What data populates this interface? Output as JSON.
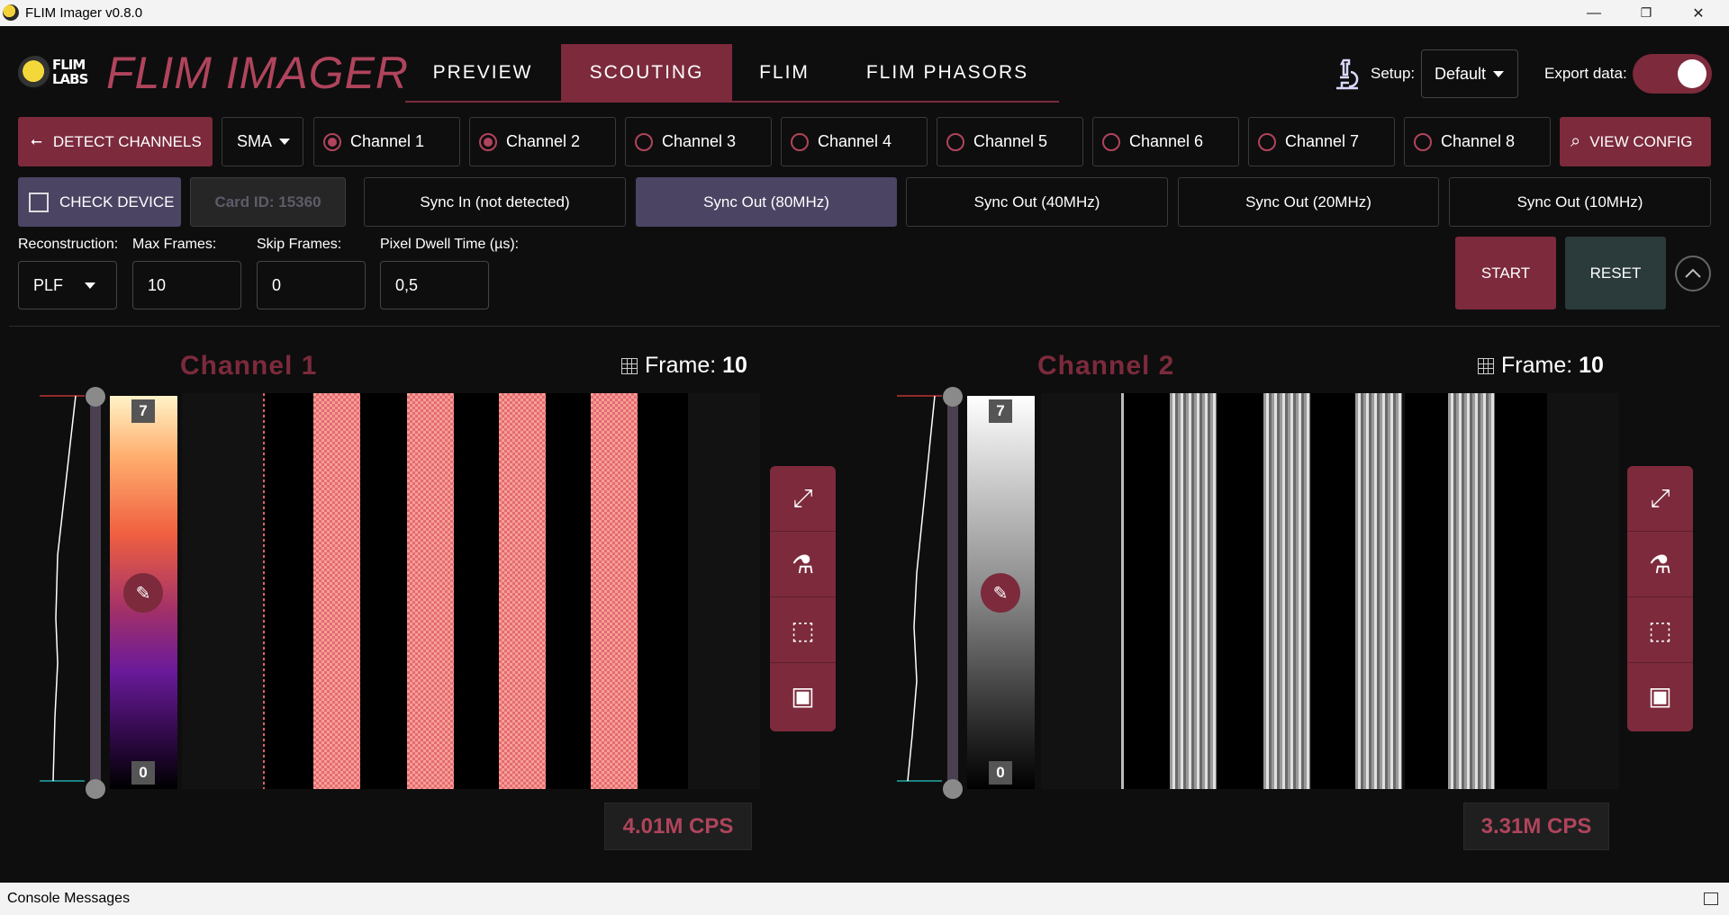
{
  "window": {
    "title": "FLIM Imager v0.8.0",
    "minimize": "—",
    "restore": "❐",
    "close": "✕"
  },
  "header": {
    "logo_text": "FLIM LABS",
    "logo_line1": "FLIM",
    "logo_line2": "LABS",
    "app_title": "FLIM IMAGER",
    "tabs": [
      {
        "label": "PREVIEW",
        "active": false
      },
      {
        "label": "SCOUTING",
        "active": true
      },
      {
        "label": "FLIM",
        "active": false
      },
      {
        "label": "FLIM PHASORS",
        "active": false
      }
    ],
    "setup_label": "Setup:",
    "setup_value": "Default",
    "export_label": "Export data:",
    "export_on": true
  },
  "channels_row": {
    "detect_label": "DETECT CHANNELS",
    "connection_value": "SMA",
    "channels": [
      {
        "label": "Channel 1",
        "checked": true
      },
      {
        "label": "Channel 2",
        "checked": true
      },
      {
        "label": "Channel 3",
        "checked": false
      },
      {
        "label": "Channel 4",
        "checked": false
      },
      {
        "label": "Channel 5",
        "checked": false
      },
      {
        "label": "Channel 6",
        "checked": false
      },
      {
        "label": "Channel 7",
        "checked": false
      },
      {
        "label": "Channel 8",
        "checked": false
      }
    ],
    "view_config_label": "VIEW CONFIG"
  },
  "device_row": {
    "check_device_label": "CHECK DEVICE",
    "card_id": "Card ID: 15360",
    "sync_options": [
      {
        "label": "Sync In (not detected)",
        "active": false
      },
      {
        "label": "Sync Out (80MHz)",
        "active": true
      },
      {
        "label": "Sync Out (40MHz)",
        "active": false
      },
      {
        "label": "Sync Out (20MHz)",
        "active": false
      },
      {
        "label": "Sync Out (10MHz)",
        "active": false
      }
    ]
  },
  "params": {
    "reconstruction_label": "Reconstruction:",
    "reconstruction_value": "PLF",
    "max_frames_label": "Max Frames:",
    "max_frames_value": "10",
    "skip_frames_label": "Skip Frames:",
    "skip_frames_value": "0",
    "dwell_label": "Pixel Dwell Time (µs):",
    "dwell_value": "0,5",
    "start_label": "START",
    "reset_label": "RESET"
  },
  "panels": [
    {
      "title": "Channel 1",
      "frame_label": "Frame:",
      "frame_value": "10",
      "max": "7",
      "min": "0",
      "cps": "4.01M CPS",
      "colormap": "hot"
    },
    {
      "title": "Channel 2",
      "frame_label": "Frame:",
      "frame_value": "10",
      "max": "7",
      "min": "0",
      "cps": "3.31M CPS",
      "colormap": "gray"
    }
  ],
  "console": {
    "label": "Console Messages"
  },
  "icons": {
    "usb": "usb-icon",
    "chip": "chip-icon",
    "microscope": "microscope-icon",
    "expand": "expand-icon",
    "roi": "roi-add-icon",
    "export_image": "image-export-icon",
    "picker": "color-picker-icon",
    "config": "config-icon"
  }
}
